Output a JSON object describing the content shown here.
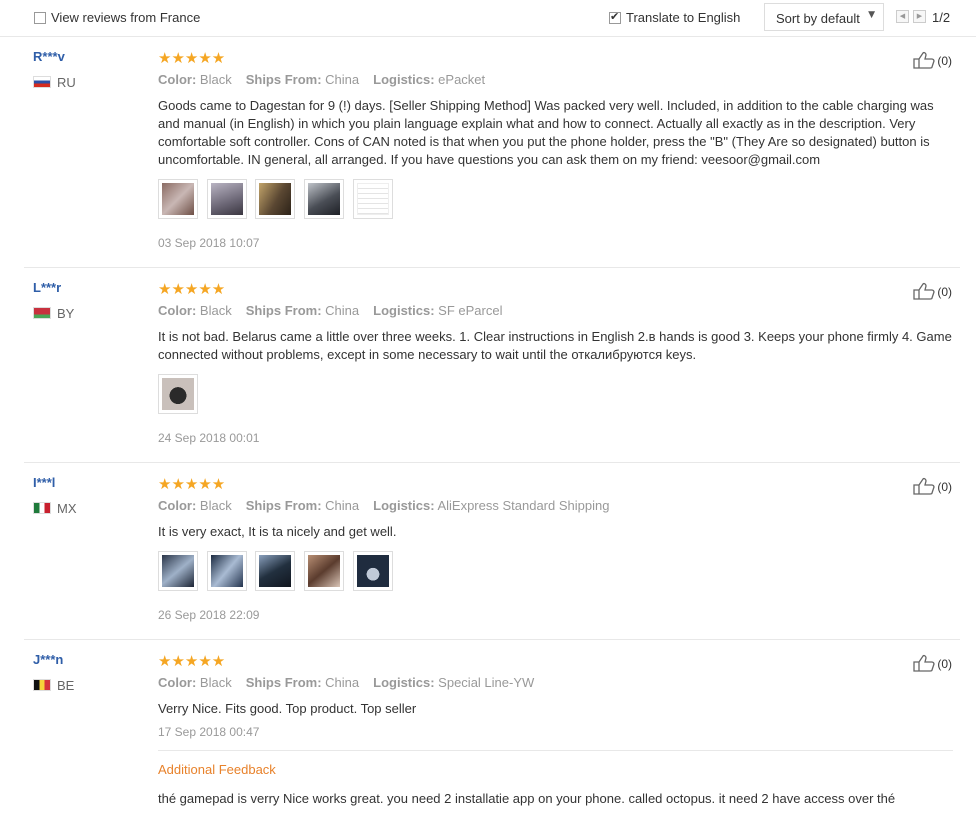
{
  "toolbar": {
    "view_reviews_label": "View reviews from France",
    "translate_label": "Translate to English",
    "sort_label": "Sort by default",
    "page_indicator": "1/2"
  },
  "reviews": [
    {
      "user": "R***v",
      "country": "RU",
      "rating": "★★★★★",
      "color_label": "Color:",
      "color": "Black",
      "ships_label": "Ships From:",
      "ships": "China",
      "logistics_label": "Logistics:",
      "logistics": "ePacket",
      "text": "Goods came to Dagestan for 9 (!) days. [Seller Shipping Method] Was packed very well. Included, in addition to the cable charging was and manual (in English) in which you plain language explain what and how to connect. Actually all exactly as in the description. Very comfortable soft controller. Cons of CAN noted is that when you put the phone holder, press the \"B\" (They Are so designated) button is uncomfortable. IN general, all arranged. If you have questions you can ask them on my friend: veesoor@gmail.com",
      "date": "03 Sep 2018 10:07",
      "likes": "(0)"
    },
    {
      "user": "L***r",
      "country": "BY",
      "rating": "★★★★★",
      "color_label": "Color:",
      "color": "Black",
      "ships_label": "Ships From:",
      "ships": "China",
      "logistics_label": "Logistics:",
      "logistics": "SF eParcel",
      "text": "It is not bad. Belarus came a little over three weeks. 1. Clear instructions in English 2.в hands is good 3. Keeps your phone firmly 4. Game connected without problems, except in some necessary to wait until the откалибруются keys.",
      "date": "24 Sep 2018 00:01",
      "likes": "(0)"
    },
    {
      "user": "I***l",
      "country": "MX",
      "rating": "★★★★★",
      "color_label": "Color:",
      "color": "Black",
      "ships_label": "Ships From:",
      "ships": "China",
      "logistics_label": "Logistics:",
      "logistics": "AliExpress Standard Shipping",
      "text": "It is very exact, It is ta nicely and get well.",
      "date": "26 Sep 2018 22:09",
      "likes": "(0)"
    },
    {
      "user": "J***n",
      "country": "BE",
      "rating": "★★★★★",
      "color_label": "Color:",
      "color": "Black",
      "ships_label": "Ships From:",
      "ships": "China",
      "logistics_label": "Logistics:",
      "logistics": "Special Line-YW",
      "text": "Verry Nice. Fits good. Top product. Top seller",
      "date": "17 Sep 2018 00:47",
      "likes": "(0)",
      "additional_feedback_label": "Additional Feedback",
      "additional_feedback": "thé gamepad is verry Nice works great. you need 2 installatie app on your phone. called octopus. it need 2 have access over thé"
    }
  ],
  "colors": {
    "username": "#2f5ea8",
    "star": "#f5a623",
    "additional_feedback": "#e8822b",
    "meta_text": "#999999"
  }
}
